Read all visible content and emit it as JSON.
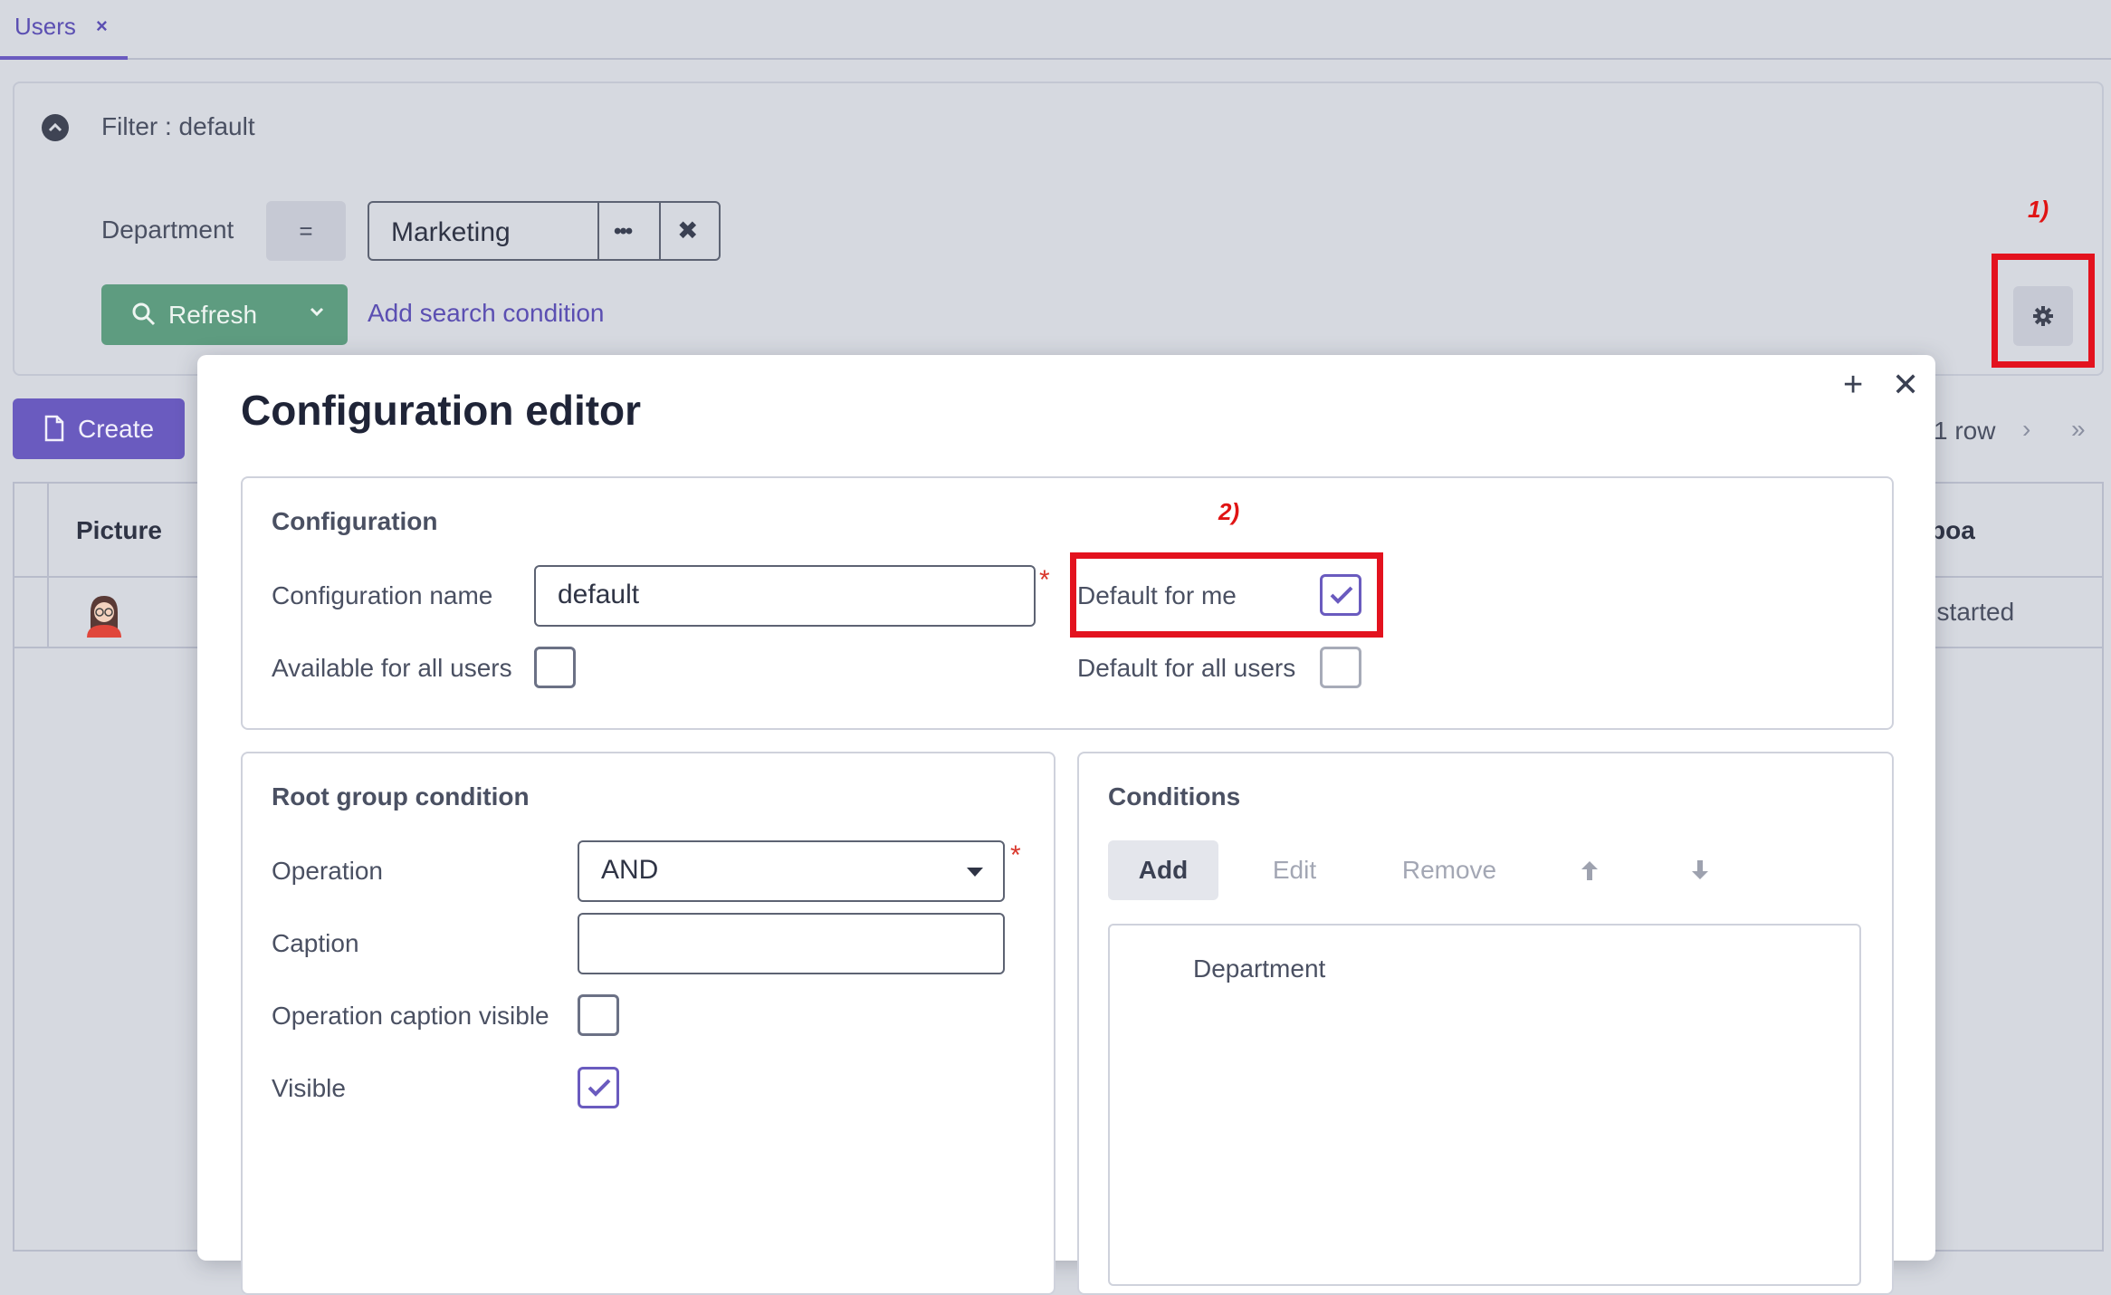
{
  "tab": {
    "label": "Users",
    "close": "×"
  },
  "filter": {
    "title": "Filter : default",
    "condition": {
      "field_label": "Department",
      "operator": "=",
      "value": "Marketing"
    },
    "refresh_label": "Refresh",
    "add_condition_label": "Add search condition"
  },
  "toolbar": {
    "create_label": "Create"
  },
  "pager": {
    "text": "1 row",
    "next": "›",
    "last": "»"
  },
  "grid": {
    "columns": [
      "Picture",
      "boa"
    ],
    "rows": [
      {
        "right_cell": ": started"
      }
    ]
  },
  "annotations": {
    "one": "1)",
    "two": "2)"
  },
  "dialog": {
    "title": "Configuration editor",
    "max_glyph": "+",
    "close_glyph": "✕",
    "configuration": {
      "title": "Configuration",
      "name_label": "Configuration name",
      "name_value": "default",
      "required_mark": "*",
      "available_all_label": "Available for all users",
      "available_all_checked": false,
      "default_me_label": "Default for me",
      "default_me_checked": true,
      "default_all_label": "Default for all users",
      "default_all_checked": false
    },
    "root_group": {
      "title": "Root group condition",
      "operation_label": "Operation",
      "operation_value": "AND",
      "caption_label": "Caption",
      "caption_value": "",
      "op_caption_visible_label": "Operation caption visible",
      "op_caption_visible_checked": false,
      "visible_label": "Visible",
      "visible_checked": true
    },
    "conditions": {
      "title": "Conditions",
      "add_label": "Add",
      "edit_label": "Edit",
      "remove_label": "Remove",
      "items": [
        "Department"
      ]
    }
  },
  "colors": {
    "accent": "#6a5bbf",
    "refresh": "#5e9c80",
    "highlight": "#e3121e"
  }
}
